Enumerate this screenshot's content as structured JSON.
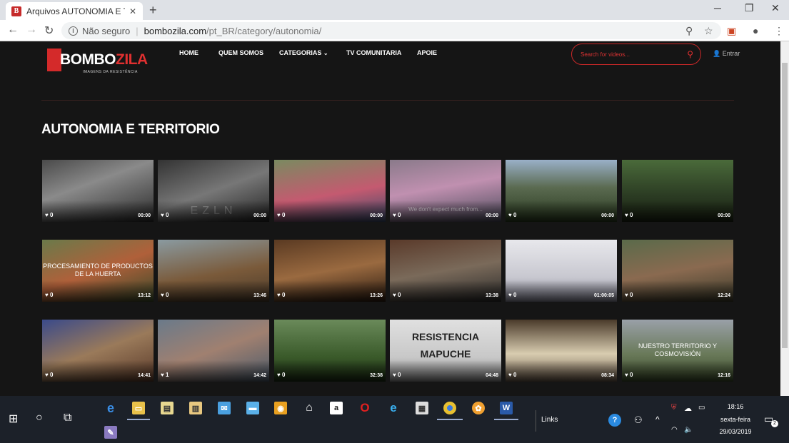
{
  "browser": {
    "tab_title": "Arquivos AUTONOMIA E TERRITORIO",
    "favicon_letter": "B",
    "insecure_label": "Não seguro",
    "url_domain": "bombozila.com",
    "url_path": "/pt_BR/category/autonomia/"
  },
  "site": {
    "logo_brand_a": "BOMBO",
    "logo_brand_b": "ZILA",
    "logo_tagline": "IMAGENS DA RESISTÊNCIA",
    "nav": [
      "HOME",
      "QUEM SOMOS",
      "CATEGORIAS",
      "TV COMUNITARIA",
      "APOIE"
    ],
    "search_placeholder": "Search for videos...",
    "login_label": "Entrar",
    "page_title": "AUTONOMIA E TERRITORIO"
  },
  "videos": [
    {
      "likes": "0",
      "duration": "00:00",
      "overlay": "",
      "bg": "linear-gradient(160deg,#4a4a4a,#8a8a8a 40%,#2a2a2a)"
    },
    {
      "likes": "0",
      "duration": "00:00",
      "overlay": "EZLN",
      "bg": "linear-gradient(160deg,#333,#777 50%,#222)"
    },
    {
      "likes": "0",
      "duration": "00:00",
      "overlay": "",
      "bg": "linear-gradient(170deg,#7a8a60,#c45a70 55%,#3a4a6a)"
    },
    {
      "likes": "0",
      "duration": "00:00",
      "overlay": "We don't expect much from...",
      "bg": "linear-gradient(170deg,#8a7a8a,#c090b0 45%,#4a4a5a)"
    },
    {
      "likes": "0",
      "duration": "00:00",
      "overlay": "",
      "bg": "linear-gradient(180deg,#9ab0c8,#5a6a50 45%,#2a3a20)"
    },
    {
      "likes": "0",
      "duration": "00:00",
      "overlay": "",
      "bg": "linear-gradient(180deg,#4a6a3a,#2a3a22 60%,#1a2212)"
    },
    {
      "likes": "0",
      "duration": "13:12",
      "overlay": "PROCESAMIENTO DE PRODUCTOS DE LA HUERTA",
      "bg": "linear-gradient(160deg,#6a7a4a,#b0603a 50%,#3a4a2a)"
    },
    {
      "likes": "0",
      "duration": "13:46",
      "overlay": "",
      "bg": "linear-gradient(170deg,#8a9aa0,#7a5a3a 55%,#4a3a2a)"
    },
    {
      "likes": "0",
      "duration": "13:26",
      "overlay": "",
      "bg": "linear-gradient(170deg,#5a3a22,#9a6a40 50%,#2a1a10)"
    },
    {
      "likes": "0",
      "duration": "13:38",
      "overlay": "",
      "bg": "linear-gradient(170deg,#5a3a2a,#7a6a5a 50%,#2a2a2a)"
    },
    {
      "likes": "0",
      "duration": "01:00:05",
      "overlay": "",
      "bg": "linear-gradient(180deg,#e8e8ec,#c8c8d0 60%,#8a8a9a)"
    },
    {
      "likes": "0",
      "duration": "12:24",
      "overlay": "",
      "bg": "linear-gradient(170deg,#5a6a4a,#8a6a50 50%,#3a3a2a)"
    },
    {
      "likes": "0",
      "duration": "14:41",
      "overlay": "",
      "bg": "linear-gradient(160deg,#3a4a8a,#9a7a5a 50%,#5a3a2a)"
    },
    {
      "likes": "1",
      "duration": "14:42",
      "overlay": "",
      "bg": "linear-gradient(160deg,#6a7a8a,#a08070 50%,#4a5a6a)"
    },
    {
      "likes": "0",
      "duration": "32:38",
      "overlay": "",
      "bg": "linear-gradient(180deg,#6a8a5a,#3a5a2a 60%,#1a2a12)"
    },
    {
      "likes": "0",
      "duration": "04:48",
      "overlay": "RESISTENCIA MAPUCHE",
      "bg": "linear-gradient(180deg,#e0e0e0,#c8c8c8 60%,#8a8a8a)"
    },
    {
      "likes": "0",
      "duration": "08:34",
      "overlay": "",
      "bg": "linear-gradient(180deg,#4a3a2a,#d8ccb0 55%,#6a5a4a)"
    },
    {
      "likes": "0",
      "duration": "12:16",
      "overlay": "NUESTRO TERRITORIO Y COSMOVISIÓN",
      "bg": "linear-gradient(180deg,#9aa0a8,#6a7a5a 55%,#3a4a2a)"
    }
  ],
  "taskbar": {
    "links_label": "Links",
    "time": "18:16",
    "weekday": "sexta-feira",
    "date": "29/03/2019",
    "notification_count": "2"
  }
}
